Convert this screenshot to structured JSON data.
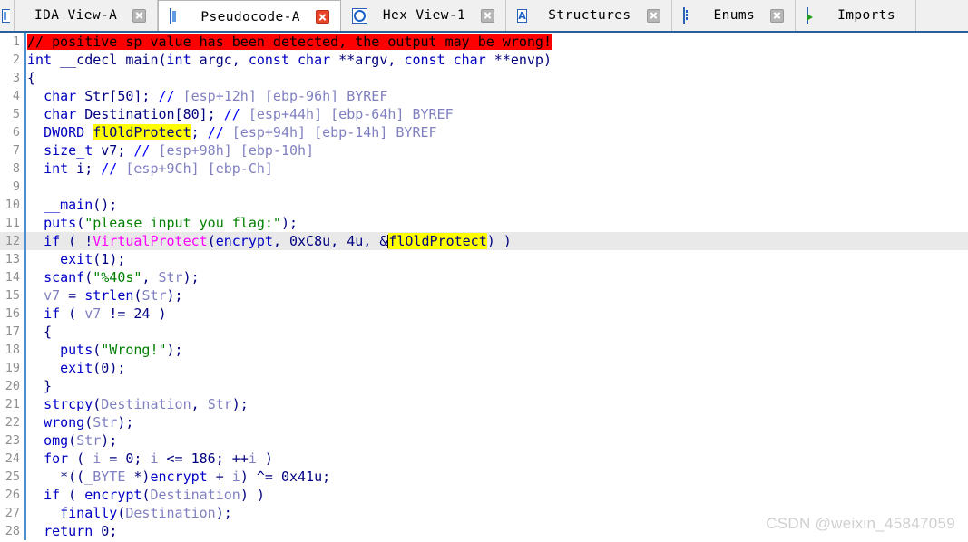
{
  "window": {
    "app": "IDA Pro",
    "active_view": "Pseudocode-A"
  },
  "tabbar": {
    "tabs": [
      {
        "label": "IDA View-A",
        "icon": "ida-view-icon",
        "active": false,
        "closable": true,
        "close_style": "gray"
      },
      {
        "label": "Pseudocode-A",
        "icon": "pseudocode-icon",
        "active": true,
        "closable": true,
        "close_style": "red"
      },
      {
        "label": "Hex View-1",
        "icon": "hex-view-icon",
        "active": false,
        "closable": true,
        "close_style": "gray"
      },
      {
        "label": "Structures",
        "icon": "structures-icon",
        "active": false,
        "closable": true,
        "close_style": "gray"
      },
      {
        "label": "Enums",
        "icon": "enums-icon",
        "active": false,
        "closable": true,
        "close_style": "gray"
      },
      {
        "label": "Imports",
        "icon": "imports-icon",
        "active": false,
        "closable": false,
        "close_style": "none"
      }
    ]
  },
  "code": {
    "highlighted_symbol": "flOldProtect",
    "current_line": 12,
    "warning_banner": "// positive sp value has been detected, the output may be wrong!",
    "lines": [
      {
        "n": 1,
        "text": "// positive sp value has been detected, the output may be wrong!"
      },
      {
        "n": 2,
        "text": "int __cdecl main(int argc, const char **argv, const char **envp)"
      },
      {
        "n": 3,
        "text": "{"
      },
      {
        "n": 4,
        "text": "  char Str[50]; // [esp+12h] [ebp-96h] BYREF"
      },
      {
        "n": 5,
        "text": "  char Destination[80]; // [esp+44h] [ebp-64h] BYREF"
      },
      {
        "n": 6,
        "text": "  DWORD flOldProtect; // [esp+94h] [ebp-14h] BYREF"
      },
      {
        "n": 7,
        "text": "  size_t v7; // [esp+98h] [ebp-10h]"
      },
      {
        "n": 8,
        "text": "  int i; // [esp+9Ch] [ebp-Ch]"
      },
      {
        "n": 9,
        "text": ""
      },
      {
        "n": 10,
        "text": "  __main();"
      },
      {
        "n": 11,
        "text": "  puts(\"please input you flag:\");"
      },
      {
        "n": 12,
        "text": "  if ( !VirtualProtect(encrypt, 0xC8u, 4u, &flOldProtect) )"
      },
      {
        "n": 13,
        "text": "    exit(1);"
      },
      {
        "n": 14,
        "text": "  scanf(\"%40s\", Str);"
      },
      {
        "n": 15,
        "text": "  v7 = strlen(Str);"
      },
      {
        "n": 16,
        "text": "  if ( v7 != 24 )"
      },
      {
        "n": 17,
        "text": "  {"
      },
      {
        "n": 18,
        "text": "    puts(\"Wrong!\");"
      },
      {
        "n": 19,
        "text": "    exit(0);"
      },
      {
        "n": 20,
        "text": "  }"
      },
      {
        "n": 21,
        "text": "  strcpy(Destination, Str);"
      },
      {
        "n": 22,
        "text": "  wrong(Str);"
      },
      {
        "n": 23,
        "text": "  omg(Str);"
      },
      {
        "n": 24,
        "text": "  for ( i = 0; i <= 186; ++i )"
      },
      {
        "n": 25,
        "text": "    *((_BYTE *)encrypt + i) ^= 0x41u;"
      },
      {
        "n": 26,
        "text": "  if ( encrypt(Destination) )"
      },
      {
        "n": 27,
        "text": "    finally(Destination);"
      },
      {
        "n": 28,
        "text": "  return 0;"
      }
    ]
  },
  "watermark": {
    "text": "CSDN @weixin_45847059"
  },
  "colors": {
    "banner_bg": "#ff0000",
    "highlight_bg": "#ffff00",
    "current_line_bg": "#e9e9e9",
    "keyword": "#0000c0",
    "string": "#008000",
    "api": "#ff00ff",
    "variable": "#8080c0",
    "gutter_text": "#8f8f8f",
    "gutter_rule": "#4f8fd0",
    "tab_active_bg": "#ffffff",
    "tab_inactive_bg": "#f0f0f0",
    "tabbar_underline": "#2a6099"
  }
}
